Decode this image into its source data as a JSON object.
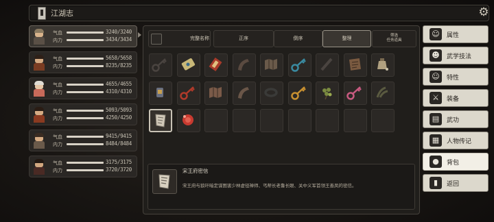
{
  "topbar": {
    "title": "江湖志"
  },
  "party": [
    {
      "hp_label": "气血",
      "hp": "3240/3240",
      "mp_label": "内力",
      "mp": "3434/3434",
      "active": true,
      "skin": "#d9b48c",
      "hair": "#8a7a60",
      "cloth": "#5a5046"
    },
    {
      "hp_label": "气血",
      "hp": "5658/5658",
      "mp_label": "内力",
      "mp": "8235/8235",
      "active": false,
      "skin": "#d6ac84",
      "hair": "#2e2018",
      "cloth": "#7a3c22"
    },
    {
      "hp_label": "气血",
      "hp": "4655/4655",
      "mp_label": "内力",
      "mp": "4310/4310",
      "active": false,
      "skin": "#e6c8a8",
      "hair": "#e0dcd4",
      "cloth": "#c86a5a"
    },
    {
      "hp_label": "气血",
      "hp": "5093/5093",
      "mp_label": "内力",
      "mp": "4250/4250",
      "active": false,
      "skin": "#d6ac84",
      "hair": "#2a1c14",
      "cloth": "#8a3a20"
    },
    {
      "hp_label": "气血",
      "hp": "9415/9415",
      "mp_label": "内力",
      "mp": "8484/8484",
      "active": false,
      "skin": "#d6ac84",
      "hair": "#3a2c22",
      "cloth": "#6a5a4a"
    },
    {
      "hp_label": "气血",
      "hp": "3175/3175",
      "mp_label": "内力",
      "mp": "3720/3720",
      "active": false,
      "skin": "#d2a880",
      "hair": "#221812",
      "cloth": "#4a2a24"
    }
  ],
  "filters": {
    "show_complete": "完整名称",
    "sort_normal": "正序",
    "sort_reverse": "倒序",
    "organize": "整理",
    "task_line1": "筛选",
    "task_line2": "任务道具"
  },
  "items": [
    {
      "icon": "key-icon",
      "color": "#4a4440"
    },
    {
      "icon": "scroll-icon",
      "color": "#c8b878"
    },
    {
      "icon": "book-icon",
      "color": "#a83a2a"
    },
    {
      "icon": "horn-icon",
      "color": "#5a4a40"
    },
    {
      "icon": "map-icon",
      "color": "#6a5a4a"
    },
    {
      "icon": "key-icon",
      "color": "#3a8aa0"
    },
    {
      "icon": "stick-icon",
      "color": "#4a4440"
    },
    {
      "icon": "parchment-icon",
      "color": "#7a5a40"
    },
    {
      "icon": "pot-icon",
      "color": "#b0a080"
    },
    {
      "icon": "lantern-icon",
      "color": "#6a7080"
    },
    {
      "icon": "key-icon",
      "color": "#b03a2a"
    },
    {
      "icon": "map-icon",
      "color": "#7a5a48"
    },
    {
      "icon": "horn-icon",
      "color": "#6a5648"
    },
    {
      "icon": "ring-icon",
      "color": "#3a3a38"
    },
    {
      "icon": "key-icon",
      "color": "#c89030"
    },
    {
      "icon": "herb-icon",
      "color": "#7a8a40"
    },
    {
      "icon": "key-icon",
      "color": "#c85a80"
    },
    {
      "icon": "claw-icon",
      "color": "#5a5a40"
    },
    {
      "icon": "letter-icon",
      "color": "#d0c8b8"
    },
    {
      "icon": "bead-icon",
      "color": "#c83a30"
    }
  ],
  "selected_item": {
    "name": "宋王府密信",
    "description": "宋王府与狼玕暗定谋图害少林虚径禅师、丐帮长老鲁长眼、关中义军首领王善凤的密信。"
  },
  "menu": [
    {
      "label": "属性",
      "icon": "person-icon",
      "glyph": "☺",
      "active": false
    },
    {
      "label": "武学技法",
      "icon": "martial-icon",
      "glyph": "☻",
      "active": false
    },
    {
      "label": "特性",
      "icon": "trait-icon",
      "glyph": "☺",
      "active": false
    },
    {
      "label": "装备",
      "icon": "sword-icon",
      "glyph": "⚔",
      "active": false
    },
    {
      "label": "武功",
      "icon": "scroll-icon",
      "glyph": "▤",
      "active": false
    },
    {
      "label": "人物传记",
      "icon": "biography-icon",
      "glyph": "▦",
      "active": false
    },
    {
      "label": "背包",
      "icon": "bag-icon",
      "glyph": "●",
      "active": true
    },
    {
      "label": "返回",
      "icon": "exit-icon",
      "glyph": "▮",
      "active": false
    }
  ]
}
